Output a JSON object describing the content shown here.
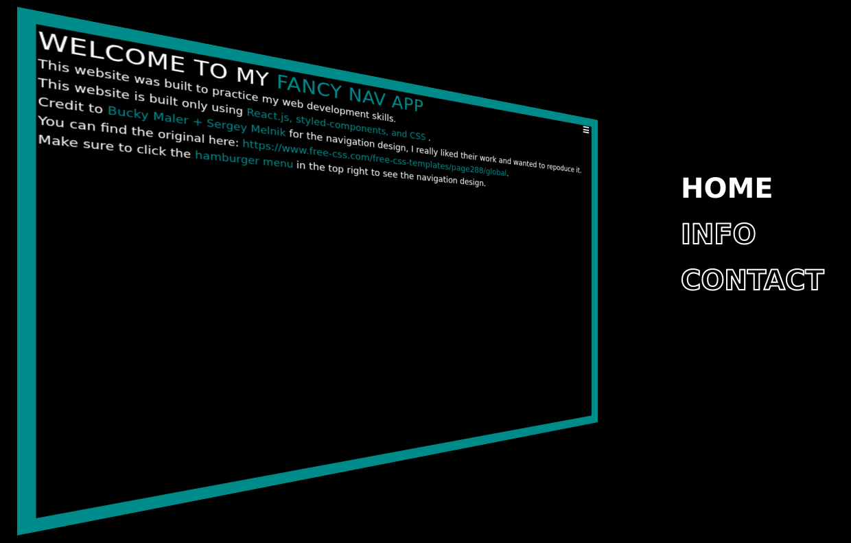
{
  "app": {
    "title_prefix": "WELCOME TO MY",
    "title_accent": "FANCY NAV APP",
    "line1": "This website was built to practice my web development skills.",
    "line2": {
      "prefix": "This website is built only using",
      "accent": "React.js, styled-components, and CSS",
      "suffix": "."
    },
    "line3": {
      "prefix": "Credit to",
      "accent": "Bucky Maler + Sergey Melnik",
      "suffix": "for the navigation design, I really liked their work and wanted to repoduce it."
    },
    "line4": {
      "prefix": "You can find the original here:",
      "link": "https://www.free-css.com/free-css-templates/page288/global",
      "suffix": "."
    },
    "line5": {
      "prefix": "Make sure to click the",
      "accent": "hamburger menu",
      "suffix": "in the top right to see the navigation design."
    },
    "hamburger_icon": "hamburger-menu-icon"
  },
  "nav": {
    "items": [
      {
        "label": "HOME",
        "state": "active"
      },
      {
        "label": "INFO",
        "state": "outline"
      },
      {
        "label": "CONTACT",
        "state": "outline"
      }
    ]
  },
  "colors": {
    "accent": "#008b8b",
    "background": "#000000",
    "text": "#ffffff"
  }
}
